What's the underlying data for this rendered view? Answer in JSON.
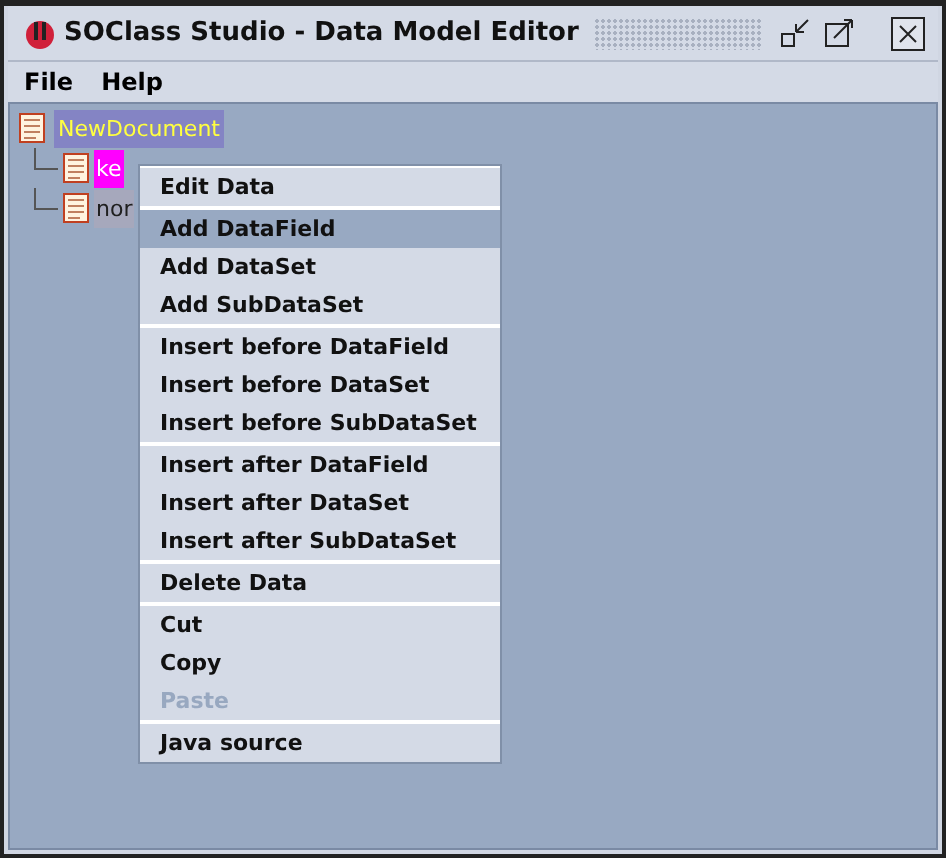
{
  "window": {
    "title": "SOClass Studio - Data Model Editor"
  },
  "menubar": [
    "File",
    "Help"
  ],
  "tree": {
    "label": "NewDocument",
    "selected": true,
    "color": "#8484c4",
    "children": [
      {
        "label": "ke",
        "selected": false,
        "highlighted": true,
        "color": "#ff00ff"
      },
      {
        "label": "nor",
        "selected": false,
        "highlighted": false,
        "color": "#a6a8bc"
      }
    ]
  },
  "context_menu": [
    [
      {
        "label": "Edit Data",
        "selected": false,
        "disabled": false
      }
    ],
    [
      {
        "label": "Add DataField",
        "selected": true,
        "disabled": false
      },
      {
        "label": "Add DataSet",
        "selected": false,
        "disabled": false
      },
      {
        "label": "Add SubDataSet",
        "selected": false,
        "disabled": false
      }
    ],
    [
      {
        "label": "Insert before DataField",
        "selected": false,
        "disabled": false
      },
      {
        "label": "Insert before DataSet",
        "selected": false,
        "disabled": false
      },
      {
        "label": "Insert before SubDataSet",
        "selected": false,
        "disabled": false
      }
    ],
    [
      {
        "label": "Insert after DataField",
        "selected": false,
        "disabled": false
      },
      {
        "label": "Insert after DataSet",
        "selected": false,
        "disabled": false
      },
      {
        "label": "Insert after SubDataSet",
        "selected": false,
        "disabled": false
      }
    ],
    [
      {
        "label": "Delete Data",
        "selected": false,
        "disabled": false
      }
    ],
    [
      {
        "label": "Cut",
        "selected": false,
        "disabled": false
      },
      {
        "label": "Copy",
        "selected": false,
        "disabled": false
      },
      {
        "label": "Paste",
        "selected": false,
        "disabled": true
      }
    ],
    [
      {
        "label": "Java source",
        "selected": false,
        "disabled": false
      }
    ]
  ]
}
